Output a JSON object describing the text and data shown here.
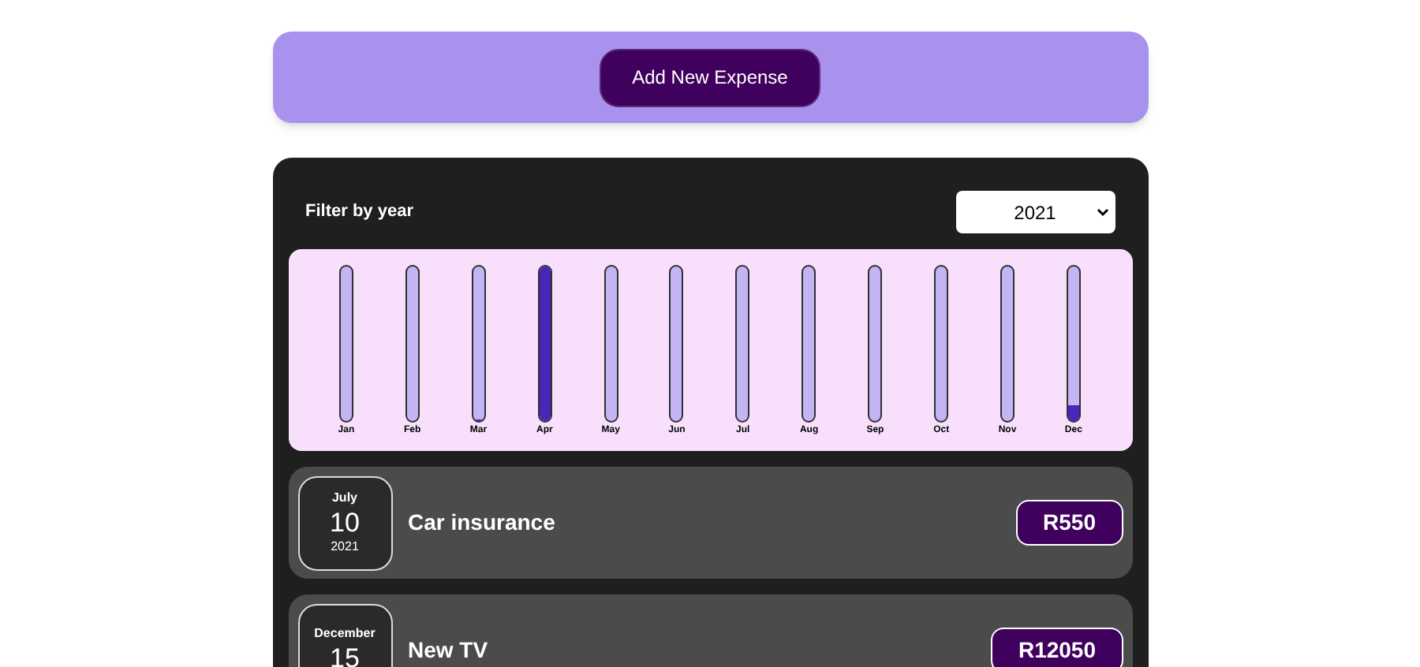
{
  "add_button": {
    "label": "Add New Expense"
  },
  "filter": {
    "label": "Filter by year",
    "value": "2021"
  },
  "months": [
    {
      "label": "Jan"
    },
    {
      "label": "Feb"
    },
    {
      "label": "Mar",
      "level": 0.01
    },
    {
      "label": "Apr",
      "level": 1
    },
    {
      "label": "May"
    },
    {
      "label": "Jun"
    },
    {
      "label": "Jul"
    },
    {
      "label": "Aug"
    },
    {
      "label": "Sep"
    },
    {
      "label": "Oct"
    },
    {
      "label": "Nov"
    },
    {
      "label": "Dec",
      "level": 0.1
    }
  ],
  "expenses": [
    {
      "month": "July",
      "day": "10",
      "year": "2021",
      "title": "Car insurance",
      "amount": "R550"
    },
    {
      "month": "December",
      "day": "15",
      "title": "New TV",
      "amount": "R12050"
    }
  ]
}
